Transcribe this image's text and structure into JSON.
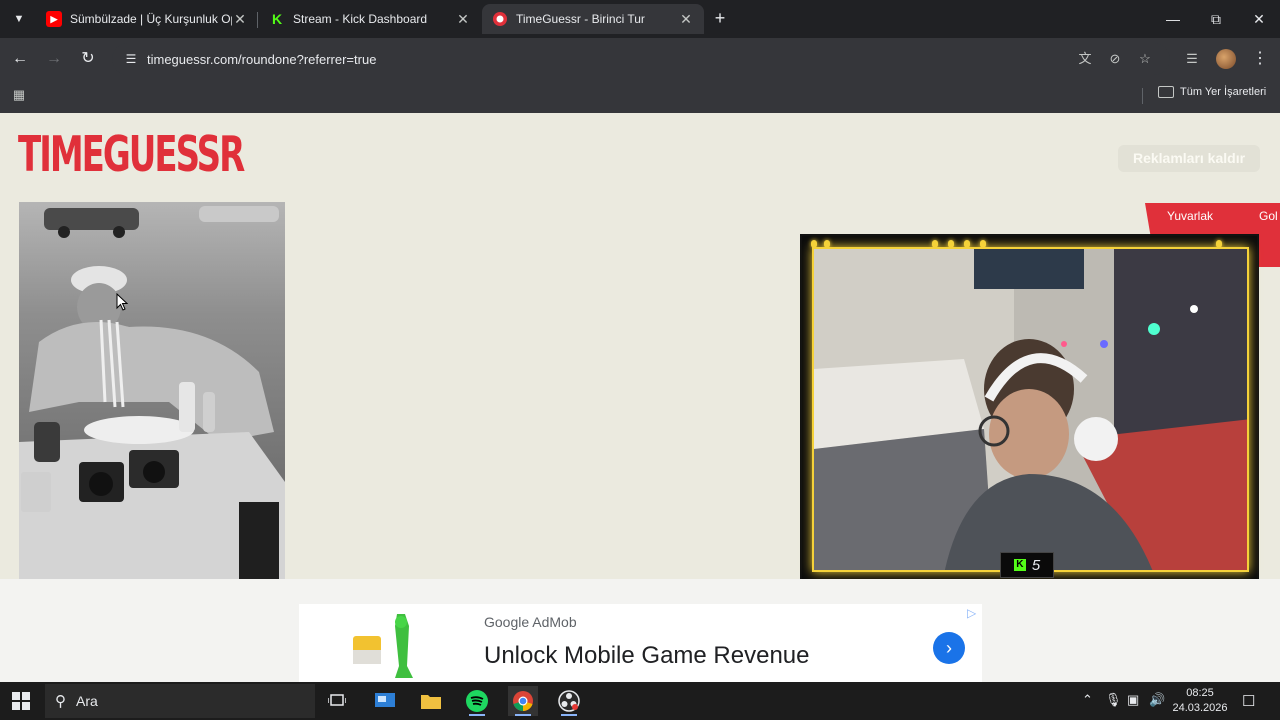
{
  "browser": {
    "tabs": [
      {
        "title": "Sümbülzade | Üç Kurşunluk Op",
        "favicon": "youtube-icon",
        "active": false
      },
      {
        "title": "Stream - Kick Dashboard",
        "favicon": "kick-icon",
        "active": false
      },
      {
        "title": "TimeGuessr - Birinci Tur",
        "favicon": "timeguessr-icon",
        "active": true
      }
    ],
    "new_tab_label": "+",
    "url": "timeguessr.com/roundone?referrer=true",
    "bookmarks_folder_label": "Tüm Yer İşaretleri"
  },
  "page": {
    "logo_text": "TIMEGUESSR",
    "remove_ads_label": "Reklamları kaldır",
    "round_badge": {
      "round_label": "Yuvarlak",
      "goal_label": "Gol"
    },
    "stream_viewers": "5"
  },
  "ad": {
    "sponsor": "Google AdMob",
    "headline": "Unlock Mobile Game Revenue"
  },
  "taskbar": {
    "search_placeholder": "Ara",
    "time": "08:25",
    "date": "24.03.2026"
  },
  "colors": {
    "brand_red": "#e0303a",
    "page_bg": "#ebeadf",
    "kick_green": "#53fc18",
    "cam_frame": "#f5d23a"
  }
}
